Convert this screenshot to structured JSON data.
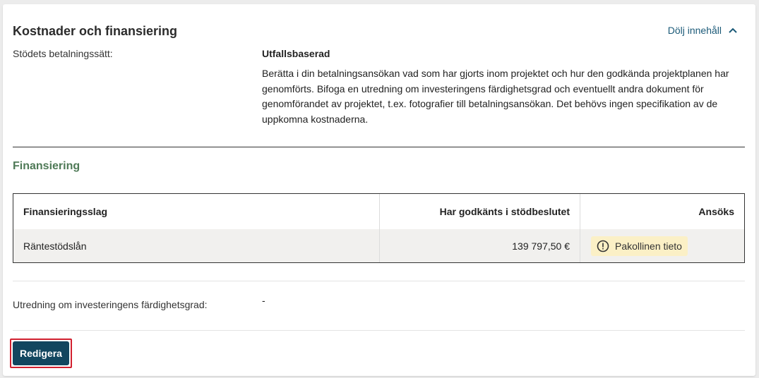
{
  "section": {
    "title": "Kostnader och finansiering",
    "toggle_label": "Dölj innehåll"
  },
  "payment": {
    "label": "Stödets betalningssätt:",
    "value": "Utfallsbaserad",
    "description": "Berätta i din betalningsansökan vad som har gjorts inom projektet och hur den godkända projektplanen har genomförts. Bifoga en utredning om investeringens färdighetsgrad och eventuellt andra dokument för genomförandet av projektet, t.ex. fotografier till betalningsansökan. Det behövs ingen specifikation av de uppkomna kostnaderna."
  },
  "financing": {
    "title": "Finansiering",
    "columns": [
      "Finansieringsslag",
      "Har godkänts i stödbeslutet",
      "Ansöks"
    ],
    "rows": [
      {
        "type": "Räntestödslån",
        "approved": "139 797,50 €",
        "applied_badge": "Pakollinen tieto"
      }
    ]
  },
  "investment": {
    "label": "Utredning om investeringens färdighetsgrad:",
    "value": "-"
  },
  "actions": {
    "edit_label": "Redigera"
  },
  "colors": {
    "accent": "#12465f",
    "link": "#1b5a78",
    "section_heading": "#4f7a57",
    "badge_bg": "#fbf0c6",
    "focus": "#d1202f"
  }
}
